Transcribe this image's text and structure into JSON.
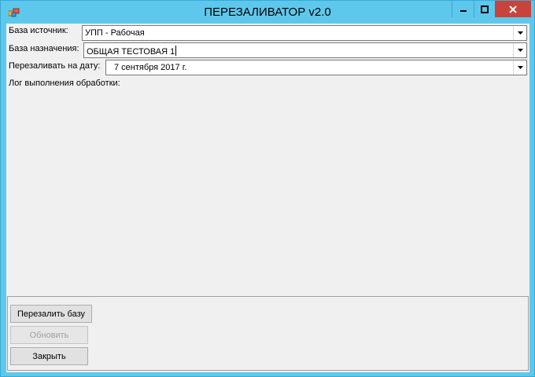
{
  "window": {
    "title": "ПЕРЕЗАЛИВАТОР v2.0"
  },
  "form": {
    "source": {
      "label": "База источник:",
      "value": "УПП - Рабочая"
    },
    "target": {
      "label": "База назначения:",
      "value": "ОБЩАЯ ТЕСТОВАЯ 1"
    },
    "date": {
      "label": "Перезаливать на дату:",
      "value": "7 сентября 2017 г."
    },
    "log_label": "Лог выполнения обработки:"
  },
  "buttons": {
    "reload": "Перезалить базу",
    "refresh": "Обновить",
    "close": "Закрыть"
  },
  "colors": {
    "titlebar": "#5ec8ec",
    "close_button": "#c7433b",
    "client_bg": "#f0f0f0"
  }
}
